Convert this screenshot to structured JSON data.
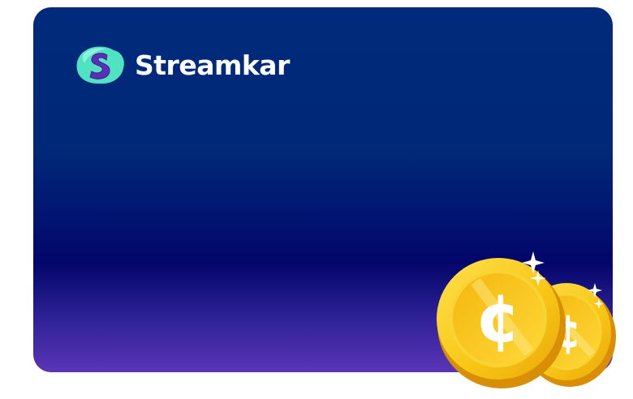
{
  "brand": {
    "name": "Streamkar",
    "logo_icon": "streamkar-s-logo-icon"
  },
  "decoration": {
    "icon": "gold-coins-icon",
    "coin_symbol": "¢"
  },
  "colors": {
    "card_top": "#012a7c",
    "card_mid": "#02066a",
    "card_bottom": "#5a35b5",
    "logo_primary": "#4fe3c1",
    "logo_letter": "#5b2fb8",
    "coin_gold": "#f7c514",
    "coin_rim": "#e0a106"
  }
}
